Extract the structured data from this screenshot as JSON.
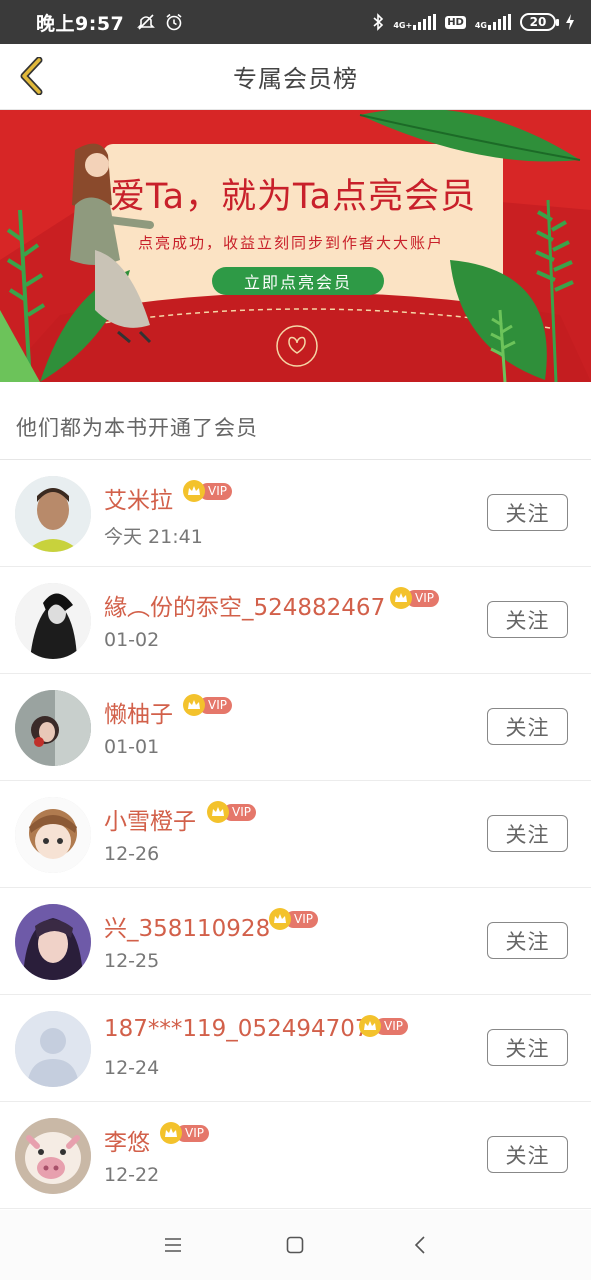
{
  "status_bar": {
    "time": "晚上9:57",
    "network_1": "4G+",
    "hd": "HD",
    "network_2": "4G",
    "battery": "20",
    "icons": [
      "mute-icon",
      "alarm-icon",
      "bluetooth-icon",
      "signal-icon",
      "hd-icon",
      "signal-icon",
      "battery-icon",
      "charging-icon"
    ]
  },
  "header": {
    "title": "专属会员榜",
    "back_icon": "back-chevron-icon",
    "accent_color": "#e0b83a"
  },
  "banner": {
    "headline": "爱Ta，就为Ta点亮会员",
    "subtitle": "点亮成功，收益立刻同步到作者大大账户",
    "cta": "立即点亮会员"
  },
  "section": {
    "title": "他们都为本书开通了会员"
  },
  "vip_label": "VIP",
  "follow_label": "关注",
  "members": [
    {
      "name": "艾米拉",
      "date": "今天 21:41"
    },
    {
      "name": "緣︵份的忝空_524882467",
      "date": "01-02"
    },
    {
      "name": "懒柚子",
      "date": "01-01"
    },
    {
      "name": "小雪橙子",
      "date": "12-26"
    },
    {
      "name": "兴_358110928",
      "date": "12-25"
    },
    {
      "name": "187***119_052494707",
      "date": "12-24"
    },
    {
      "name": "李悠",
      "date": "12-22"
    }
  ],
  "nav": {
    "icons": [
      "menu-icon",
      "home-square-icon",
      "back-triangle-icon"
    ]
  },
  "colors": {
    "name": "#d2604a",
    "vip_pill": "#e5776a",
    "vip_crown": "#f3c22c",
    "banner_red": "#d72626",
    "cta_green": "#2e9a46"
  }
}
